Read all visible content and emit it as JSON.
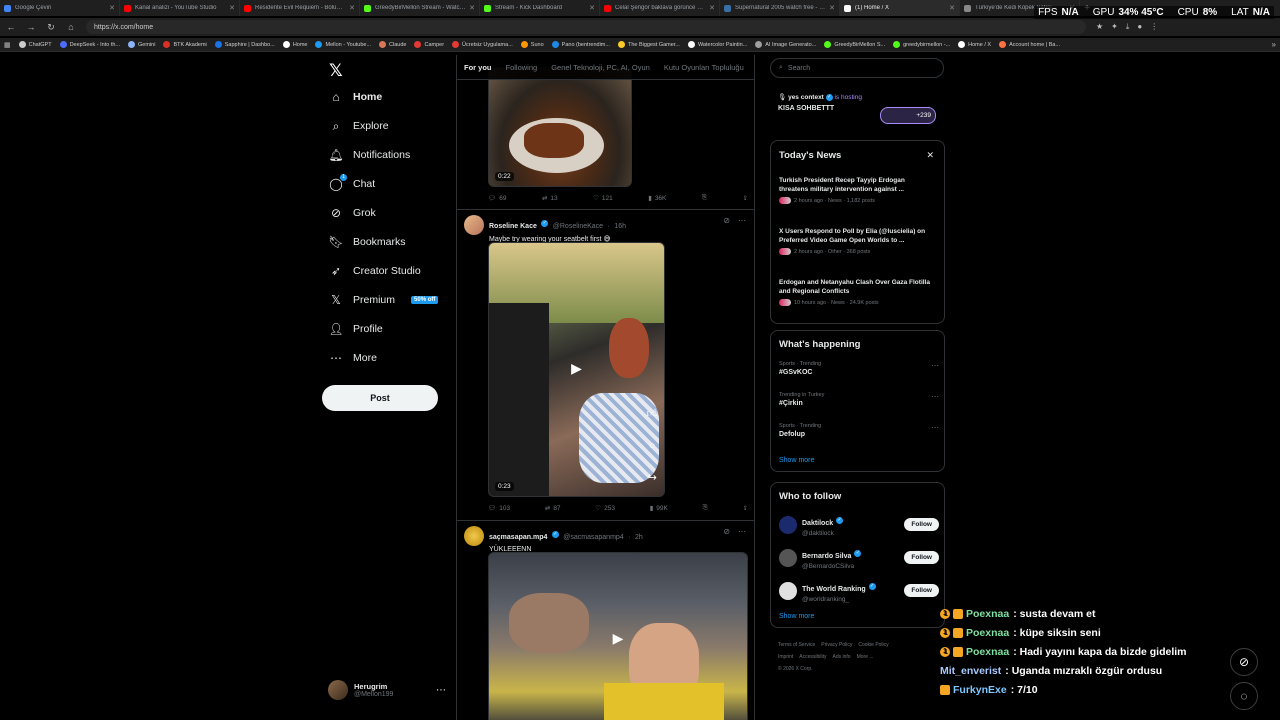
{
  "browser": {
    "tabs": [
      {
        "title": "Google Çeviri",
        "color": "#4285f4"
      },
      {
        "title": "Kanal analizi - YouTube Studio",
        "color": "#ff0000"
      },
      {
        "title": "Residente Evil Requiem - Bölüm...",
        "color": "#ff0000"
      },
      {
        "title": "GreedyBirMellon Stream - Watch...",
        "color": "#53fc18"
      },
      {
        "title": "Stream - Kick Dashboard",
        "color": "#53fc18"
      },
      {
        "title": "Celal Şengör baklava görünce ha...",
        "color": "#ff0000"
      },
      {
        "title": "Supernatural 2005 watch free - M...",
        "color": "#3a6ea5"
      },
      {
        "title": "(1) Home / X",
        "color": "#ffffff"
      },
      {
        "title": "Türkiye'de Kedi Köpek Satışı...",
        "color": "#888888"
      }
    ],
    "url": "https://x.com/home",
    "bookmarks": [
      {
        "label": "ChatGPT",
        "color": "#cccccc"
      },
      {
        "label": "DeepSeek - Into th...",
        "color": "#4d6bfe"
      },
      {
        "label": "Gemini",
        "color": "#8ab4f8"
      },
      {
        "label": "BTK Akademi",
        "color": "#d93025"
      },
      {
        "label": "Sapphire | Dashbo...",
        "color": "#1a73e8"
      },
      {
        "label": "Home",
        "color": "#ffffff"
      },
      {
        "label": "Mellon - Youtube...",
        "color": "#1d9bf0"
      },
      {
        "label": "Claude",
        "color": "#d97757"
      },
      {
        "label": "Camper",
        "color": "#e53935"
      },
      {
        "label": "Ücretsiz Uygulama...",
        "color": "#e53935"
      },
      {
        "label": "Suno",
        "color": "#ff9800"
      },
      {
        "label": "Pano (bentrendim...",
        "color": "#1e88e5"
      },
      {
        "label": "The Biggest Gamer...",
        "color": "#ffca28"
      },
      {
        "label": "Watercolor Paintin...",
        "color": "#ffffff"
      },
      {
        "label": "AI Image Generato...",
        "color": "#9e9e9e"
      },
      {
        "label": "GreedyBirMellon S...",
        "color": "#53fc18"
      },
      {
        "label": "greedybirmellon -...",
        "color": "#53fc18"
      },
      {
        "label": "Home / X",
        "color": "#ffffff"
      },
      {
        "label": "Account home | Ba...",
        "color": "#ff7043"
      }
    ]
  },
  "perf": {
    "fps_label": "FPS",
    "fps": "N/A",
    "gpu_label": "GPU",
    "gpu": "34% 45°C",
    "cpu_label": "CPU",
    "cpu": "8%",
    "lat_label": "LAT",
    "lat": "N/A"
  },
  "nav": {
    "items": [
      {
        "label": "Home",
        "icon": "home-icon",
        "glyph": "⌂"
      },
      {
        "label": "Explore",
        "icon": "search-icon",
        "glyph": "⌕"
      },
      {
        "label": "Notifications",
        "icon": "bell-icon",
        "glyph": "🔔︎"
      },
      {
        "label": "Chat",
        "icon": "chat-icon",
        "glyph": "◯"
      },
      {
        "label": "Grok",
        "icon": "grok-icon",
        "glyph": "⊘"
      },
      {
        "label": "Bookmarks",
        "icon": "bookmark-icon",
        "glyph": "🔖︎"
      },
      {
        "label": "Creator Studio",
        "icon": "rocket-icon",
        "glyph": "➶"
      },
      {
        "label": "Premium",
        "icon": "x-icon",
        "glyph": "𝕏"
      },
      {
        "label": "Profile",
        "icon": "person-icon",
        "glyph": "👤︎"
      },
      {
        "label": "More",
        "icon": "more-icon",
        "glyph": "⋯"
      }
    ],
    "premium_badge": "50% off",
    "chat_badge": "1",
    "post_label": "Post",
    "account": {
      "name": "Herugrim",
      "handle": "@Mellon199"
    }
  },
  "feed": {
    "tabs": [
      "For you",
      "Following",
      "Genel Teknoloji, PC, AI, Oyun",
      "Kutu Oyunları Topluluğu"
    ],
    "post0": {
      "duration": "0:22",
      "replies": "69",
      "reposts": "13",
      "likes": "121",
      "views": "36K"
    },
    "post1": {
      "name": "Roseline Kace",
      "handle": "@RoselineKace",
      "time": "16h",
      "text": "Maybe try wearing your seatbelt first 😅",
      "duration": "0:23",
      "replies": "103",
      "reposts": "87",
      "likes": "253",
      "views": "99K"
    },
    "post2": {
      "name": "saçmasapan.mp4",
      "handle": "@sacmasapanmp4",
      "time": "2h",
      "text": "YÜKLEEENN"
    }
  },
  "right": {
    "search_placeholder": "Search",
    "space": {
      "host": "yes context",
      "hosting": "is hosting",
      "title": "KISA SOHBETTT",
      "count": "+239"
    },
    "news_title": "Today's News",
    "news": [
      {
        "headline": "Turkish President Recep Tayyip Erdogan threatens military intervention against ...",
        "meta": "2 hours ago · News · 1,182 posts"
      },
      {
        "headline": "X Users Respond to Poll by Elia (@luscielia) on Preferred Video Game Open Worlds to ...",
        "meta": "2 hours ago · Other · 368 posts"
      },
      {
        "headline": "Erdogan and Netanyahu Clash Over Gaza Flotilla and Regional Conflicts",
        "meta": "10 hours ago · News · 24.9K posts"
      }
    ],
    "happening_title": "What's happening",
    "trends": [
      {
        "category": "Sports · Trending",
        "topic": "#GSvKOC"
      },
      {
        "category": "Trending in Turkey",
        "topic": "#Çirkin"
      },
      {
        "category": "Sports · Trending",
        "topic": "Defolup"
      }
    ],
    "show_more": "Show more",
    "wtf_title": "Who to follow",
    "follow": [
      {
        "name": "Daktilock",
        "handle": "@daktilock",
        "color": "#1a2a6c"
      },
      {
        "name": "Bernardo Silva",
        "handle": "@BernardoCSilva",
        "color": "#555555"
      },
      {
        "name": "The World Ranking",
        "handle": "@worldranking_",
        "color": "#e0e0e0"
      }
    ],
    "follow_label": "Follow",
    "footer": [
      "Terms of Service",
      "Privacy Policy",
      "Cookie Policy",
      "Imprint",
      "Accessibility",
      "Ads info",
      "More ...",
      "© 2026 X Corp."
    ]
  },
  "chat": [
    {
      "user": "Poexnaa",
      "message": ": susta devam et",
      "color": "#7ee0a1",
      "badges": 2
    },
    {
      "user": "Poexnaa",
      "message": ": küpe siksin seni",
      "color": "#7ee0a1",
      "badges": 2
    },
    {
      "user": "Poexnaa",
      "message": ": Hadi yayını kapa da bizde gidelim",
      "color": "#7ee0a1",
      "badges": 2
    },
    {
      "user": "Mit_enverist",
      "message": ": Uganda mızraklı özgür ordusu",
      "color": "#a8c8ff",
      "badges": 0
    },
    {
      "user": "FurkynExe",
      "message": ": 7/10",
      "color": "#7ec8ff",
      "badges": 1
    }
  ]
}
